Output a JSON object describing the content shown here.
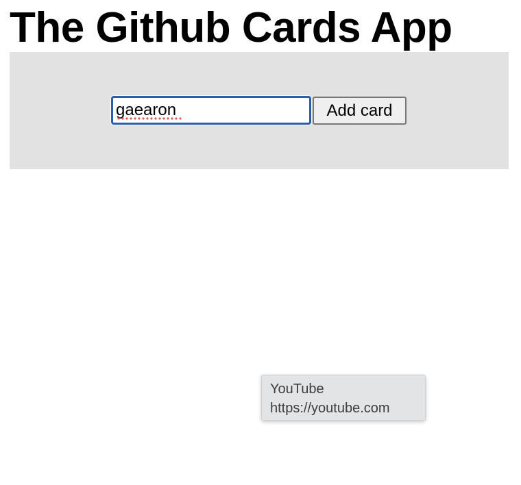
{
  "page": {
    "title": "The Github Cards App"
  },
  "form": {
    "username_value": "gaearon",
    "add_button_label": "Add card"
  },
  "tooltip": {
    "title": "YouTube",
    "url": "https://youtube.com"
  },
  "colors": {
    "panel_background": "#e2e2e2",
    "input_focus_border": "#2a5db0",
    "spellcheck_underline": "#e05a5a",
    "tooltip_background": "#e3e4e6"
  }
}
